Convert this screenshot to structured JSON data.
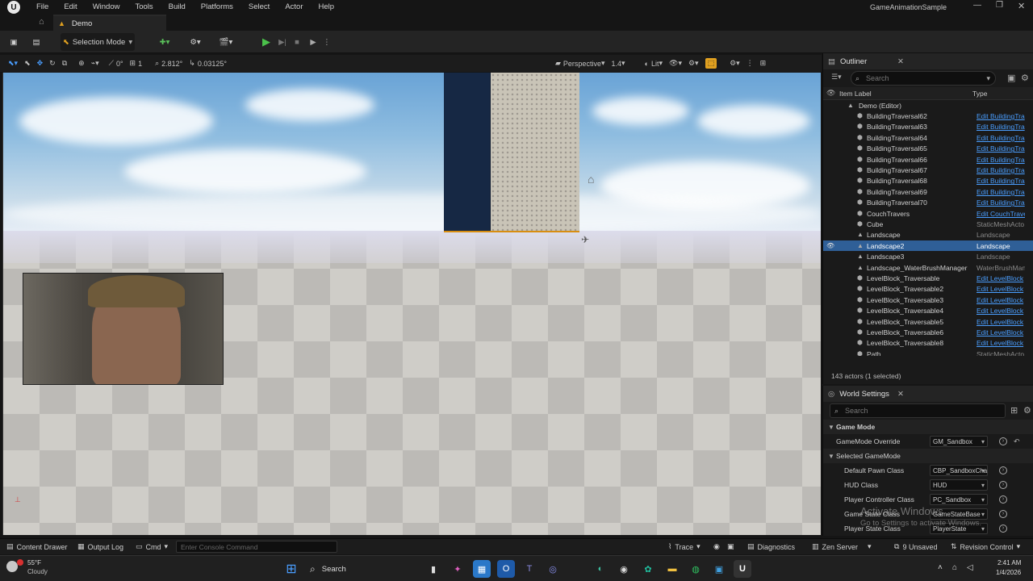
{
  "app": {
    "window_title": "GameAnimationSample",
    "menu": [
      "File",
      "Edit",
      "Window",
      "Tools",
      "Build",
      "Platforms",
      "Select",
      "Actor",
      "Help"
    ],
    "tab": "Demo"
  },
  "toolbar": {
    "selection_mode": "Selection Mode"
  },
  "viewport_toolbar": {
    "rotate_step": "0°",
    "scale_step": "1",
    "camera_speed": "2.812°",
    "snap_value": "0.03125°",
    "view_mode": "Perspective",
    "fov": "1.4",
    "lighting": "Lit"
  },
  "outliner": {
    "tab_label": "Outliner",
    "search_placeholder": "Search",
    "col_label": "Item Label",
    "col_type": "Type",
    "root": "Demo (Editor)",
    "rows": [
      {
        "name": "BuildingTraversal62",
        "type": "Edit BuildingTra",
        "link": true
      },
      {
        "name": "BuildingTraversal63",
        "type": "Edit BuildingTra",
        "link": true
      },
      {
        "name": "BuildingTraversal64",
        "type": "Edit BuildingTra",
        "link": true
      },
      {
        "name": "BuildingTraversal65",
        "type": "Edit BuildingTra",
        "link": true
      },
      {
        "name": "BuildingTraversal66",
        "type": "Edit BuildingTra",
        "link": true
      },
      {
        "name": "BuildingTraversal67",
        "type": "Edit BuildingTra",
        "link": true
      },
      {
        "name": "BuildingTraversal68",
        "type": "Edit BuildingTra",
        "link": true
      },
      {
        "name": "BuildingTraversal69",
        "type": "Edit BuildingTra",
        "link": true
      },
      {
        "name": "BuildingTraversal70",
        "type": "Edit BuildingTra",
        "link": true
      },
      {
        "name": "CouchTravers",
        "type": "Edit CouchTrave",
        "link": true
      },
      {
        "name": "Cube",
        "type": "StaticMeshActo",
        "link": false
      },
      {
        "name": "Landscape",
        "type": "Landscape",
        "link": false
      },
      {
        "name": "Landscape2",
        "type": "Landscape",
        "link": false,
        "selected": true
      },
      {
        "name": "Landscape3",
        "type": "Landscape",
        "link": false
      },
      {
        "name": "Landscape_WaterBrushManager",
        "type": "WaterBrushMan",
        "link": false
      },
      {
        "name": "LevelBlock_Traversable",
        "type": "Edit LevelBlock",
        "link": true
      },
      {
        "name": "LevelBlock_Traversable2",
        "type": "Edit LevelBlock",
        "link": true
      },
      {
        "name": "LevelBlock_Traversable3",
        "type": "Edit LevelBlock",
        "link": true
      },
      {
        "name": "LevelBlock_Traversable4",
        "type": "Edit LevelBlock",
        "link": true
      },
      {
        "name": "LevelBlock_Traversable5",
        "type": "Edit LevelBlock",
        "link": true
      },
      {
        "name": "LevelBlock_Traversable6",
        "type": "Edit LevelBlock",
        "link": true
      },
      {
        "name": "LevelBlock_Traversable8",
        "type": "Edit LevelBlock",
        "link": true
      },
      {
        "name": "Path",
        "type": "StaticMeshActo",
        "link": false
      }
    ],
    "status": "143 actors (1 selected)"
  },
  "world_settings": {
    "tab_label": "World Settings",
    "search_placeholder": "Search",
    "section_game_mode": "Game Mode",
    "game_mode_override_label": "GameMode Override",
    "game_mode_override_value": "GM_Sandbox",
    "section_selected": "Selected GameMode",
    "props": [
      {
        "label": "Default Pawn Class",
        "value": "CBP_SandboxCha"
      },
      {
        "label": "HUD Class",
        "value": "HUD"
      },
      {
        "label": "Player Controller Class",
        "value": "PC_Sandbox"
      },
      {
        "label": "Game State Class",
        "value": "GameStateBase"
      },
      {
        "label": "Player State Class",
        "value": "PlayerState"
      }
    ]
  },
  "statusbar": {
    "content_drawer": "Content Drawer",
    "output_log": "Output Log",
    "cmd": "Cmd",
    "console_placeholder": "Enter Console Command",
    "trace": "Trace",
    "diagnostics": "Diagnostics",
    "zen_server": "Zen Server",
    "unsaved": "9 Unsaved",
    "revision_control": "Revision Control"
  },
  "watermark": {
    "line1": "Activate Windows",
    "line2": "Go to Settings to activate Windows."
  },
  "taskbar": {
    "weather_temp": "55°F",
    "weather_desc": "Cloudy",
    "search": "Search",
    "time": "2:41 AM",
    "date": "1/4/2026"
  },
  "colors": {
    "accent_blue": "#2f5f97",
    "link_blue": "#4a9eff",
    "play_green": "#4bc24b",
    "selection_orange": "#d88e10"
  }
}
